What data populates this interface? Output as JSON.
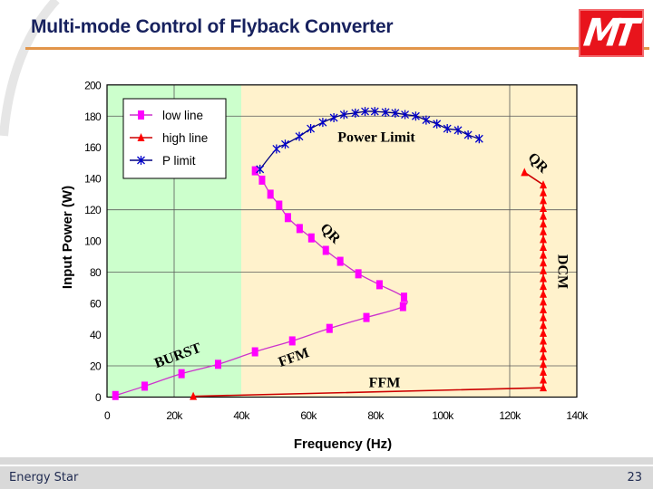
{
  "slide": {
    "title": "Multi-mode Control of Flyback Converter",
    "logo_text": "MT",
    "footer_left": "Energy Star",
    "page_number": "23"
  },
  "colors": {
    "title": "#17215e",
    "title_rule": "#e2954a",
    "logo_red": "#e8141c",
    "footer_bg": "#d9d9d9"
  },
  "chart_data": {
    "type": "line",
    "title": "",
    "xlabel": "Frequency (Hz)",
    "ylabel": "Input Power (W)",
    "xlim": [
      0,
      140000
    ],
    "ylim": [
      0,
      200
    ],
    "x_ticks": [
      0,
      20000,
      40000,
      60000,
      80000,
      100000,
      120000,
      140000
    ],
    "x_tick_labels": [
      "0",
      "20k",
      "40k",
      "60k",
      "80k",
      "100k",
      "120k",
      "140k"
    ],
    "y_ticks": [
      0,
      20,
      40,
      60,
      80,
      100,
      120,
      140,
      160,
      180,
      200
    ],
    "y_tick_labels": [
      "0",
      "20",
      "40",
      "60",
      "80",
      "100",
      "120",
      "140",
      "160",
      "180",
      "200"
    ],
    "grid": {
      "x": [
        20000,
        120000
      ],
      "y": [
        20,
        80,
        120,
        180
      ]
    },
    "shaded_regions": [
      {
        "x_range": [
          0,
          40000
        ],
        "color": "#ccffcc"
      },
      {
        "x_range": [
          40000,
          140000
        ],
        "color": "#fff2cc"
      }
    ],
    "legend": {
      "position": "top-left"
    },
    "series": [
      {
        "name": "low line",
        "marker": "square",
        "color": "#ff00ff",
        "line_color": "#cc33cc",
        "smooth": true,
        "points": [
          [
            2500,
            1
          ],
          [
            11200,
            7
          ],
          [
            22200,
            15
          ],
          [
            33100,
            21
          ],
          [
            44100,
            29
          ],
          [
            55200,
            36
          ],
          [
            66300,
            44
          ],
          [
            77300,
            51
          ],
          [
            88200,
            58
          ],
          [
            88500,
            64
          ],
          [
            81200,
            72
          ],
          [
            74900,
            79
          ],
          [
            69500,
            87
          ],
          [
            65200,
            94
          ],
          [
            60900,
            102
          ],
          [
            57400,
            108
          ],
          [
            53900,
            115
          ],
          [
            51300,
            123
          ],
          [
            48700,
            130
          ],
          [
            46200,
            139
          ],
          [
            44100,
            145
          ]
        ]
      },
      {
        "name": "high line",
        "marker": "triangle",
        "color": "#ff0000",
        "line_color": "#cc0000",
        "smooth": false,
        "points": [
          [
            25700,
            0.5
          ],
          [
            130000,
            6
          ],
          [
            130000,
            11
          ],
          [
            130000,
            16
          ],
          [
            130000,
            21
          ],
          [
            130000,
            26
          ],
          [
            130000,
            31
          ],
          [
            130000,
            36
          ],
          [
            130000,
            41
          ],
          [
            130000,
            46
          ],
          [
            130000,
            51
          ],
          [
            130000,
            56
          ],
          [
            130000,
            61
          ],
          [
            130000,
            66
          ],
          [
            130000,
            71
          ],
          [
            130000,
            76
          ],
          [
            130000,
            81
          ],
          [
            130000,
            86
          ],
          [
            130000,
            91
          ],
          [
            130000,
            96
          ],
          [
            130000,
            101
          ],
          [
            130000,
            106
          ],
          [
            130000,
            111
          ],
          [
            130000,
            116
          ],
          [
            130000,
            121
          ],
          [
            130000,
            126
          ],
          [
            130000,
            131
          ],
          [
            130000,
            136
          ],
          [
            124400,
            144
          ]
        ]
      },
      {
        "name": "P limit",
        "marker": "star",
        "color": "#0000cc",
        "line_color": "#000080",
        "smooth": true,
        "points": [
          [
            45600,
            146
          ],
          [
            50500,
            159
          ],
          [
            53100,
            162
          ],
          [
            57300,
            167
          ],
          [
            60700,
            172
          ],
          [
            64300,
            176
          ],
          [
            67600,
            179
          ],
          [
            70600,
            181
          ],
          [
            74000,
            182
          ],
          [
            76900,
            183
          ],
          [
            79800,
            183
          ],
          [
            83000,
            182.5
          ],
          [
            85900,
            182
          ],
          [
            88800,
            181
          ],
          [
            92000,
            180
          ],
          [
            95100,
            177.5
          ],
          [
            98300,
            175
          ],
          [
            101400,
            172
          ],
          [
            104600,
            171
          ],
          [
            107600,
            168
          ],
          [
            110900,
            165.5
          ]
        ]
      }
    ],
    "annotations": [
      "Power Limit",
      "QR",
      "QR",
      "DCM",
      "BURST",
      "FFM",
      "FFM"
    ]
  }
}
